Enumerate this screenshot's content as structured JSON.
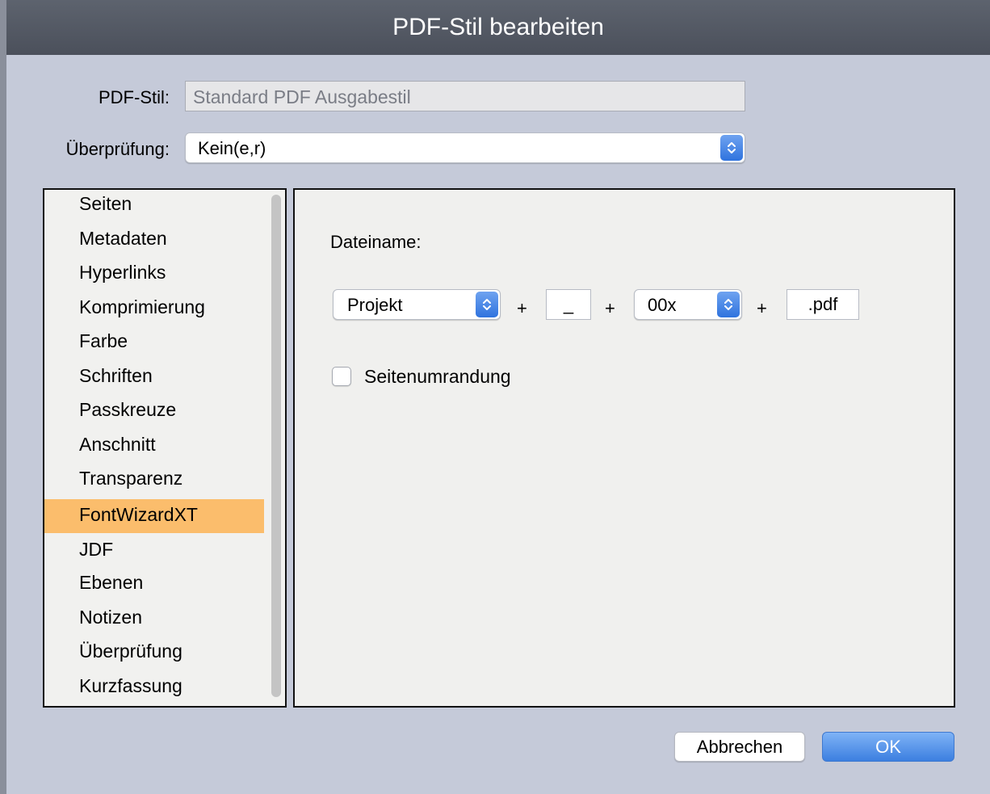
{
  "dialog": {
    "title": "PDF-Stil bearbeiten"
  },
  "form": {
    "pdf_stil_label": "PDF-Stil:",
    "pdf_stil_value": "Standard PDF Ausgabestil",
    "pruefung_label": "Überprüfung:",
    "pruefung_value": "Kein(e,r)"
  },
  "sidebar": {
    "items": [
      {
        "label": "Seiten"
      },
      {
        "label": "Metadaten"
      },
      {
        "label": "Hyperlinks"
      },
      {
        "label": "Komprimierung"
      },
      {
        "label": "Farbe"
      },
      {
        "label": "Schriften"
      },
      {
        "label": "Passkreuze"
      },
      {
        "label": "Anschnitt"
      },
      {
        "label": "Transparenz"
      },
      {
        "label": "FontWizardXT"
      },
      {
        "label": "JDF"
      },
      {
        "label": "Ebenen"
      },
      {
        "label": "Notizen"
      },
      {
        "label": "Überprüfung"
      },
      {
        "label": "Kurzfassung"
      }
    ],
    "selected": "FontWizardXT",
    "selected_color": "#fbbd6c"
  },
  "content": {
    "dateiname_label": "Dateiname:",
    "projekt_value": "Projekt",
    "plus_sign": "+",
    "separator_value": "_",
    "number_value": "00x",
    "extension_value": ".pdf",
    "seitenumrandung_label": "Seitenumrandung",
    "seitenumrandung_checked": false
  },
  "buttons": {
    "cancel_label": "Abbrechen",
    "ok_label": "OK"
  },
  "colors": {
    "background": "#c5cad9",
    "titlebar": "#50555f",
    "accent": "#3c7fe0"
  }
}
